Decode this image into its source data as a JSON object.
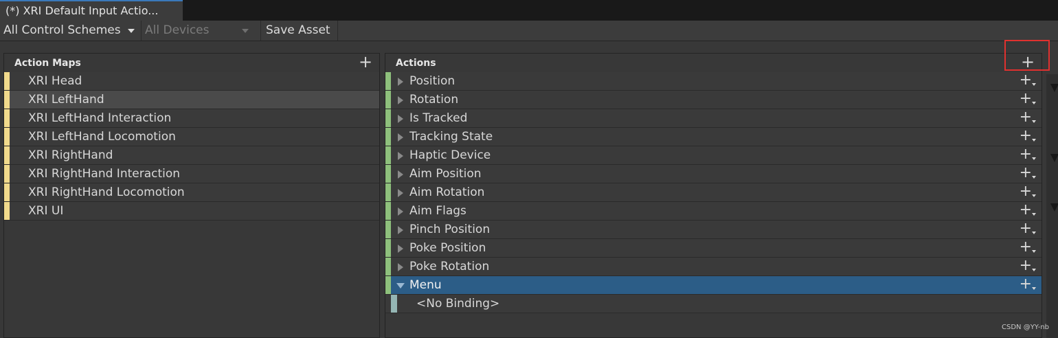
{
  "tab": {
    "title": "(*) XRI Default Input Actio..."
  },
  "toolbar": {
    "control_schemes": "All Control Schemes",
    "devices": "All Devices",
    "save_asset": "Save Asset"
  },
  "action_maps": {
    "header": "Action Maps",
    "add_icon": "+",
    "items": [
      {
        "label": "XRI Head"
      },
      {
        "label": "XRI LeftHand"
      },
      {
        "label": "XRI LeftHand Interaction"
      },
      {
        "label": "XRI LeftHand Locomotion"
      },
      {
        "label": "XRI RightHand"
      },
      {
        "label": "XRI RightHand Interaction"
      },
      {
        "label": "XRI RightHand Locomotion"
      },
      {
        "label": "XRI UI"
      }
    ],
    "selected_index": 1
  },
  "actions": {
    "header": "Actions",
    "add_icon": "+",
    "row_add_icon": "+",
    "items": [
      {
        "label": "Position"
      },
      {
        "label": "Rotation"
      },
      {
        "label": "Is Tracked"
      },
      {
        "label": "Tracking State"
      },
      {
        "label": "Haptic Device"
      },
      {
        "label": "Aim Position"
      },
      {
        "label": "Aim Rotation"
      },
      {
        "label": "Aim Flags"
      },
      {
        "label": "Pinch Position"
      },
      {
        "label": "Poke Position"
      },
      {
        "label": "Poke Rotation"
      },
      {
        "label": "Menu"
      }
    ],
    "selected_index": 11,
    "binding": "<No Binding>"
  },
  "watermark": "CSDN @YY-nb",
  "colors": {
    "action_map_stripe": "#f1da8c",
    "action_stripe": "#8ec07c",
    "binding_stripe": "#95b6b4",
    "selection": "#2c5d87",
    "highlight_box": "#e0312f"
  }
}
